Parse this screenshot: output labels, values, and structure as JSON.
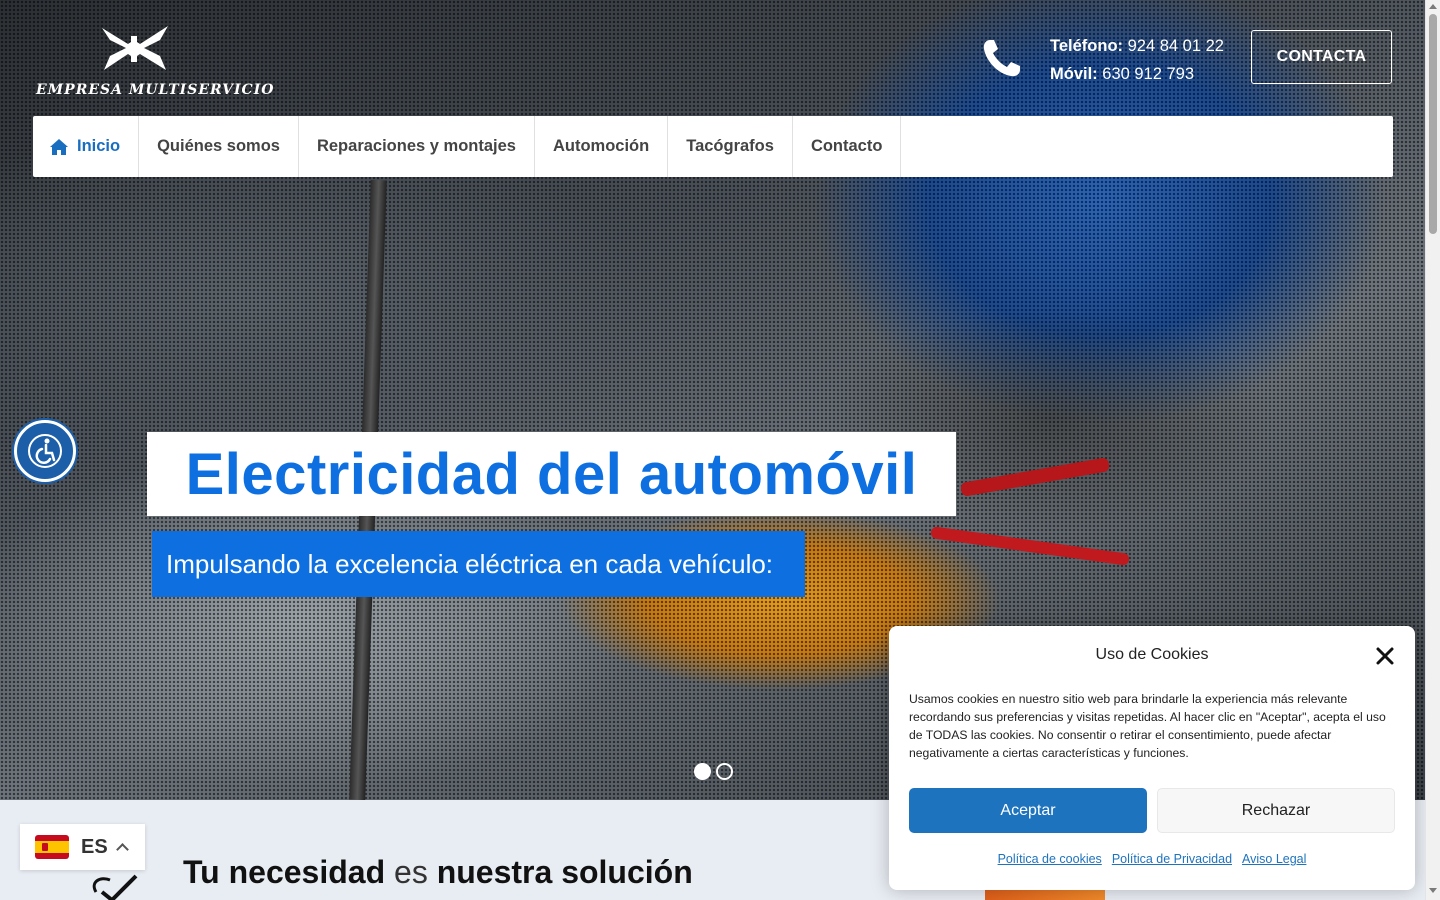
{
  "header": {
    "logo_text": "EMPRESA MULTISERVICIO",
    "phone_label": "Teléfono:",
    "phone_value": "924 84 01 22",
    "mobile_label": "Móvil:",
    "mobile_value": "630 912 793",
    "contact_button": "CONTACTA"
  },
  "nav": {
    "items": [
      {
        "label": "Inicio",
        "icon": "home-icon",
        "active": true
      },
      {
        "label": "Quiénes somos"
      },
      {
        "label": "Reparaciones y montajes"
      },
      {
        "label": "Automoción"
      },
      {
        "label": "Tacógrafos"
      },
      {
        "label": "Contacto"
      }
    ]
  },
  "hero": {
    "title": "Electricidad del automóvil",
    "subtitle": "Impulsando la excelencia eléctrica en cada vehículo:",
    "slides": 2,
    "active_slide": 1
  },
  "section": {
    "title_part1": "Tu necesidad",
    "title_part2": "es",
    "title_part3": "nuestra solución"
  },
  "language": {
    "code": "ES",
    "flag": "spain-flag-icon"
  },
  "cookie_banner": {
    "title": "Uso de Cookies",
    "text": "Usamos cookies en nuestro sitio web para brindarle la experiencia más relevante recordando sus preferencias y visitas repetidas. Al hacer clic en \"Aceptar\", acepta el uso de TODAS las cookies. No consentir o retirar el consentimiento, puede afectar negativamente a ciertas características y funciones.",
    "accept": "Aceptar",
    "reject": "Rechazar",
    "links": [
      "Política de cookies",
      "Política de Privacidad",
      "Aviso Legal"
    ]
  },
  "colors": {
    "brand_blue": "#0d6fe0",
    "accept_blue": "#1e73be",
    "nav_active": "#1a6ec0"
  }
}
